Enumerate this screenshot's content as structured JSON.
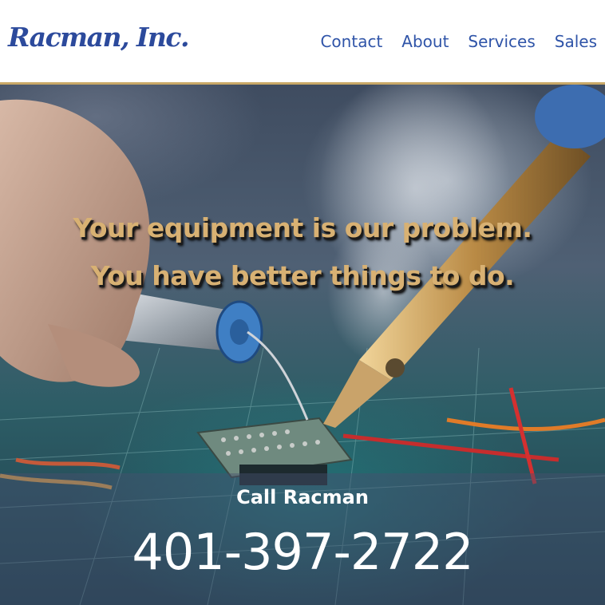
{
  "header": {
    "logo_text": "Racman, Inc.",
    "nav": [
      {
        "label": "Contact"
      },
      {
        "label": "About"
      },
      {
        "label": "Services"
      },
      {
        "label": "Sales"
      }
    ]
  },
  "hero": {
    "tagline_line1": "Your equipment is our problem.",
    "tagline_line2": "You have better things to do.",
    "cta_label": "Call Racman",
    "phone": "401-397-2722",
    "image_subject": "hand soldering a circuit board"
  },
  "colors": {
    "brand_blue": "#2c4a9c",
    "nav_blue": "#2f54a8",
    "accent_gold": "#c9a867",
    "tagline_gold": "#d8b173",
    "cta_text": "#ffffff"
  }
}
